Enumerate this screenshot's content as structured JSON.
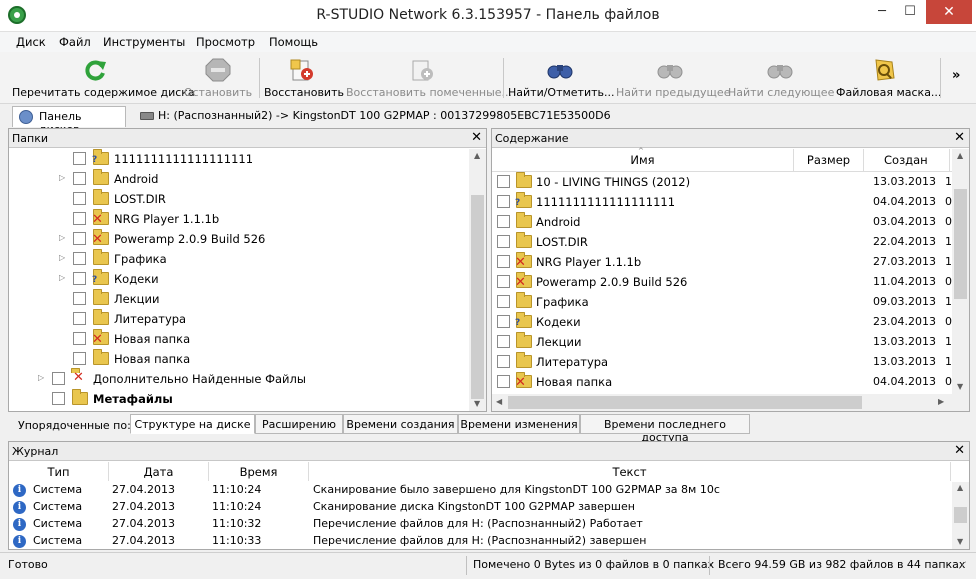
{
  "window": {
    "title": "R-STUDIO Network 6.3.153957 - Панель файлов"
  },
  "menu": [
    "Диск",
    "Файл",
    "Инструменты",
    "Просмотр",
    "Помощь"
  ],
  "toolbar": {
    "rescan": "Перечитать содержимое диска",
    "stop": "Остановить",
    "recover": "Восстановить",
    "recover_marked": "Восстановить помеченные...",
    "find_mark": "Найти/Отметить...",
    "find_prev": "Найти предыдущее",
    "find_next": "Найти следующее",
    "file_mask": "Файловая маска...",
    "more": "»"
  },
  "tabs": {
    "disks": "Панель дисков",
    "drive": "H: (Распознанный2) -> KingstonDT 100 G2PMAP : 00137299805EBC71E53500D6"
  },
  "folders_pane": {
    "title": "Папки",
    "close": "✕",
    "items": [
      {
        "name": "1111111111111111111"
      },
      {
        "name": "Android"
      },
      {
        "name": "LOST.DIR"
      },
      {
        "name": "NRG Player 1.1.1b"
      },
      {
        "name": "Poweramp 2.0.9 Build 526"
      },
      {
        "name": "Графика"
      },
      {
        "name": "Кодеки"
      },
      {
        "name": "Лекции"
      },
      {
        "name": "Литература"
      },
      {
        "name": "Новая папка"
      },
      {
        "name": "Новая папка"
      },
      {
        "name": "Дополнительно Найденные Файлы"
      },
      {
        "name": "Метафайлы"
      }
    ]
  },
  "contents_pane": {
    "title": "Содержание",
    "close": "✕",
    "columns": {
      "name": "Имя",
      "size": "Размер",
      "created": "Создан"
    },
    "rows": [
      {
        "name": "10 - LIVING THINGS (2012)",
        "created": "13.03.2013"
      },
      {
        "name": "1111111111111111111",
        "created": "04.04.2013"
      },
      {
        "name": "Android",
        "created": "03.04.2013"
      },
      {
        "name": "LOST.DIR",
        "created": "22.04.2013"
      },
      {
        "name": "NRG Player 1.1.1b",
        "created": "27.03.2013"
      },
      {
        "name": "Poweramp 2.0.9 Build 526",
        "created": "11.04.2013"
      },
      {
        "name": "Графика",
        "created": "09.03.2013"
      },
      {
        "name": "Кодеки",
        "created": "23.04.2013"
      },
      {
        "name": "Лекции",
        "created": "13.03.2013"
      },
      {
        "name": "Литература",
        "created": "13.03.2013"
      },
      {
        "name": "Новая папка",
        "created": "04.04.2013"
      }
    ]
  },
  "sort_bar": {
    "label": "Упорядоченные по:",
    "tabs": [
      "Структуре на диске",
      "Расширению",
      "Времени создания",
      "Времени изменения",
      "Времени последнего доступа"
    ]
  },
  "journal": {
    "title": "Журнал",
    "close": "✕",
    "columns": {
      "type": "Тип",
      "date": "Дата",
      "time": "Время",
      "text": "Текст"
    },
    "rows": [
      {
        "type": "Система",
        "date": "27.04.2013",
        "time": "11:10:24",
        "text": "Сканирование было завершено для KingstonDT 100 G2PMAP за 8м 10с"
      },
      {
        "type": "Система",
        "date": "27.04.2013",
        "time": "11:10:24",
        "text": "Сканирование диска KingstonDT 100 G2PMAP завершен"
      },
      {
        "type": "Система",
        "date": "27.04.2013",
        "time": "11:10:32",
        "text": "Перечисление файлов для H: (Распознанный2) Работает"
      },
      {
        "type": "Система",
        "date": "27.04.2013",
        "time": "11:10:33",
        "text": "Перечисление файлов для H: (Распознанный2) завершен"
      }
    ]
  },
  "status": {
    "ready": "Готово",
    "marked": "Помечено 0 Bytes из 0 файлов в 0 папках",
    "total": "Всего 94.59 GB из 982 файлов в 44 папках"
  },
  "colors": {
    "folder": "#e9c64e",
    "close_button": "#c7463a",
    "info_icon": "#2e68c4",
    "error_mark": "#d32a1f"
  }
}
